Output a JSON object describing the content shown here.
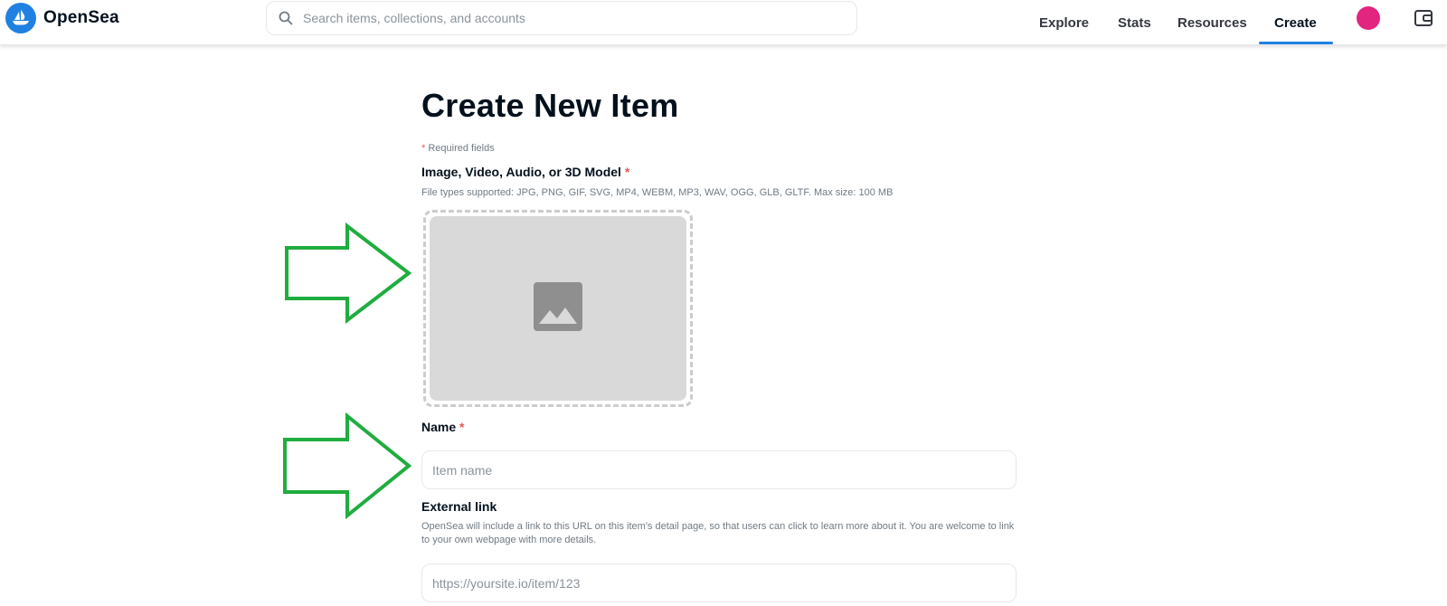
{
  "header": {
    "logo_text": "OpenSea",
    "search": {
      "placeholder": "Search items, collections, and accounts",
      "value": ""
    },
    "nav": [
      {
        "label": "Explore",
        "active": false
      },
      {
        "label": "Stats",
        "active": false
      },
      {
        "label": "Resources",
        "active": false
      },
      {
        "label": "Create",
        "active": true
      }
    ],
    "icons": {
      "logo": "opensea-boat-icon",
      "search": "search-icon",
      "avatar": "avatar",
      "wallet": "wallet-icon"
    }
  },
  "form": {
    "title": "Create New Item",
    "required_note": "Required fields",
    "required_mark": "*",
    "media": {
      "label": "Image, Video, Audio, or 3D Model",
      "help": "File types supported: JPG, PNG, GIF, SVG, MP4, WEBM, MP3, WAV, OGG, GLB, GLTF. Max size: 100 MB",
      "icon": "image-placeholder-icon"
    },
    "name": {
      "label": "Name",
      "placeholder": "Item name",
      "value": ""
    },
    "external_link": {
      "label": "External link",
      "help": "OpenSea will include a link to this URL on this item's detail page, so that users can click to learn more about it. You are welcome to link to your own webpage with more details.",
      "placeholder": "https://yoursite.io/item/123",
      "value": ""
    }
  },
  "annotations": {
    "arrow_color": "#1fad3f",
    "arrows": [
      "annotation-arrow-media",
      "annotation-arrow-name"
    ]
  },
  "colors": {
    "brand_blue": "#2081e2",
    "required_red": "#eb5757",
    "avatar_pink": "#e2257f"
  }
}
